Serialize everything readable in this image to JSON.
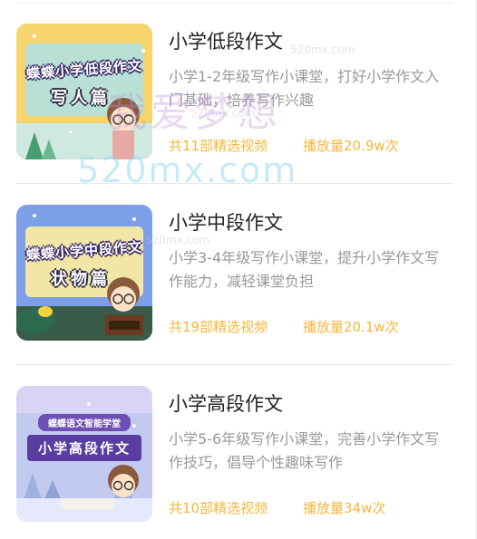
{
  "courses": [
    {
      "title": "小学低段作文",
      "desc": "小学1-2年级写作小课堂，打好小学作文入门基础，培养写作兴趣",
      "count": "共11部精选视频",
      "plays": "播放量20.9w次",
      "thumb_banner": "蝶蝶小学低段作文",
      "thumb_tag": "写人篇",
      "thumb_bg": "#bfe3d8"
    },
    {
      "title": "小学中段作文",
      "desc": "小学3-4年级写作小课堂，提升小学作文写作能力，减轻课堂负担",
      "count": "共19部精选视频",
      "plays": "播放量20.1w次",
      "thumb_banner": "蝶蝶小学中段作文",
      "thumb_tag": "状物篇",
      "thumb_bg": "#8fb0f0"
    },
    {
      "title": "小学高段作文",
      "desc": "小学5-6年级写作小课堂，完善小学作文写作技巧，倡导个性趣味写作",
      "count": "共10部精选视频",
      "plays": "播放量34w次",
      "thumb_banner": "蝶蝶语文智能学堂",
      "thumb_tag": "小学高段作文",
      "thumb_bg": "#c7cef2"
    }
  ],
  "watermark": {
    "cn": "我爱梦想",
    "big": "520mx.com",
    "small": "520mx.com"
  },
  "colors": {
    "accent": "#f7b63a",
    "title": "#222222",
    "desc": "#999999"
  }
}
